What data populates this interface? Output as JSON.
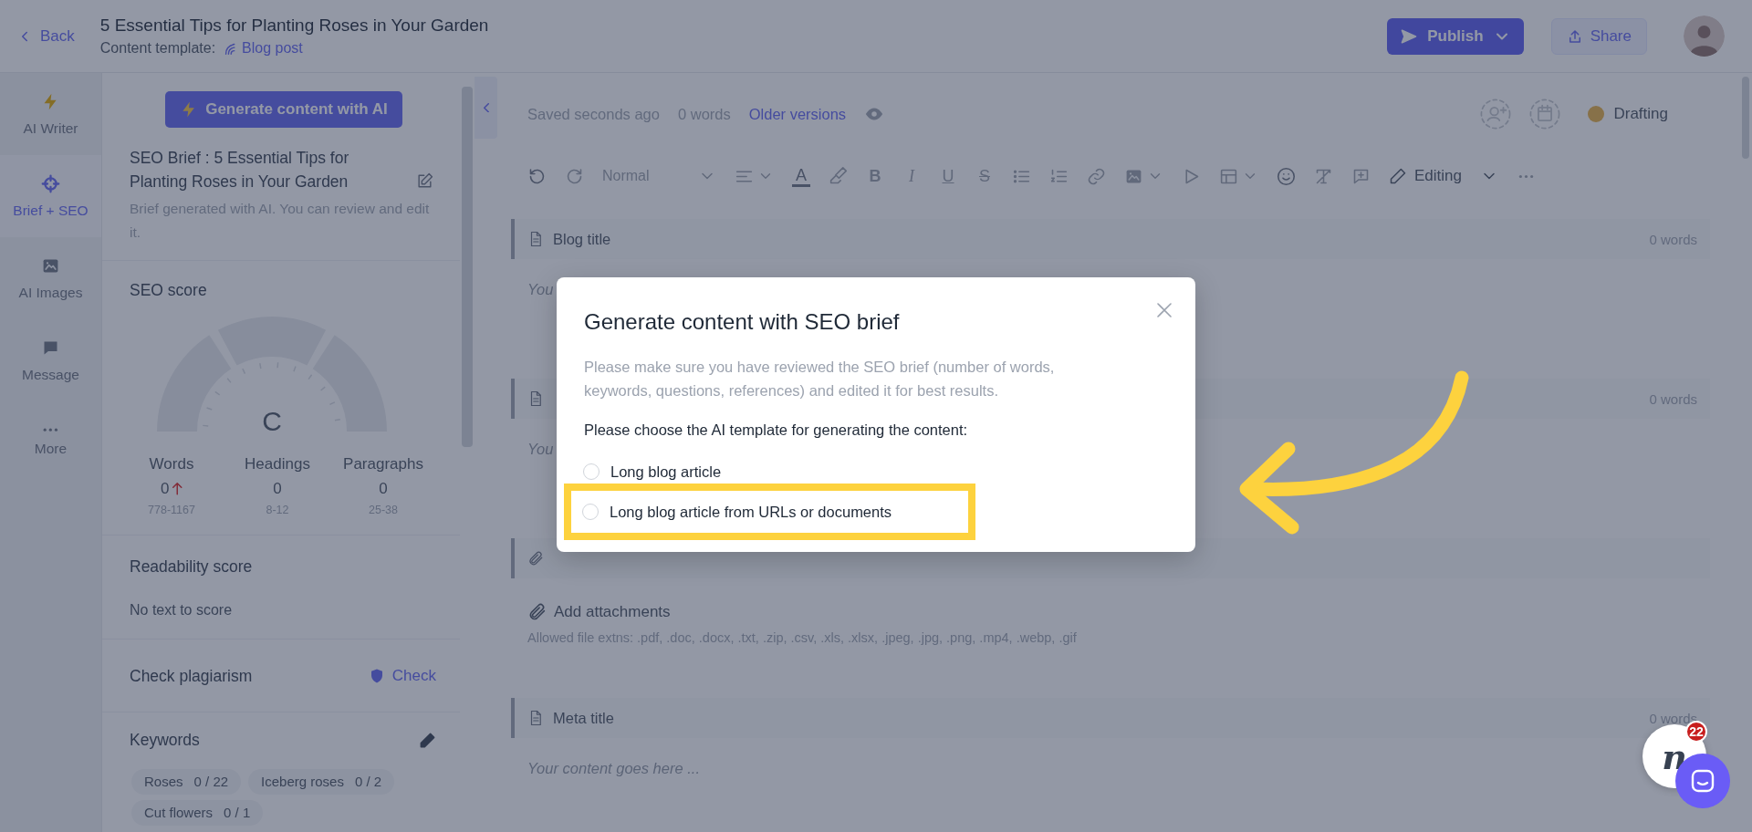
{
  "header": {
    "back": "Back",
    "title": "5 Essential Tips for Planting Roses in Your Garden",
    "template_label": "Content template:",
    "template": "Blog post",
    "publish": "Publish",
    "share": "Share"
  },
  "rail": [
    {
      "label": "AI Writer",
      "selected": false
    },
    {
      "label": "Brief + SEO",
      "selected": true
    },
    {
      "label": "AI Images",
      "selected": false
    },
    {
      "label": "Message",
      "selected": false
    },
    {
      "label": "More",
      "selected": false
    }
  ],
  "brief": {
    "generate_button": "Generate content with AI",
    "title": "SEO Brief : 5 Essential Tips for Planting Roses in Your Garden",
    "note": "Brief generated with AI. You can review and edit it."
  },
  "seo_score": {
    "heading": "SEO score",
    "grade": "C",
    "metrics": [
      {
        "label": "Words",
        "value": "0",
        "range": "778-1167",
        "rising": true
      },
      {
        "label": "Headings",
        "value": "0",
        "range": "8-12",
        "rising": false
      },
      {
        "label": "Paragraphs",
        "value": "0",
        "range": "25-38",
        "rising": false
      }
    ]
  },
  "readability": {
    "heading": "Readability score",
    "text": "No text to score"
  },
  "plagiarism": {
    "heading": "Check plagiarism",
    "action": "Check"
  },
  "keywords": {
    "heading": "Keywords",
    "items": [
      {
        "label": "Roses",
        "count": "0 / 22"
      },
      {
        "label": "Iceberg roses",
        "count": "0 / 2"
      },
      {
        "label": "Cut flowers",
        "count": "0 / 1"
      }
    ]
  },
  "editor": {
    "status": "Saved seconds ago",
    "word_count": "0 words",
    "older_versions": "Older versions",
    "state": "Drafting",
    "toolbar": {
      "style": "Normal",
      "text_color": "A",
      "marks": [
        "B",
        "I",
        "U",
        "S"
      ],
      "mode": "Editing"
    },
    "sections": [
      {
        "kind": "text",
        "title": "Blog title",
        "words": "0 words",
        "placeholder": "You"
      },
      {
        "kind": "text",
        "words": "0 words",
        "placeholder": "You"
      },
      {
        "kind": "attachment",
        "action": "Add attachments",
        "hint": "Allowed file extns: .pdf, .doc, .docx, .txt, .zip, .csv, .xls, .xlsx, .jpeg, .jpg, .png, .mp4, .webp, .gif"
      },
      {
        "kind": "text",
        "title": "Meta title",
        "words": "0 words",
        "placeholder": "Your content goes here ..."
      }
    ]
  },
  "modal": {
    "title": "Generate content with SEO brief",
    "note": "Please make sure you have reviewed the SEO brief (number of words, keywords, questions, references) and edited it for best results.",
    "prompt": "Please choose the AI template for generating the content:",
    "options": [
      {
        "label": "Long blog article",
        "selected": false,
        "highlighted": false
      },
      {
        "label": "Long blog article from URLs or documents",
        "selected": false,
        "highlighted": true
      }
    ]
  },
  "chat": {
    "logo": "n",
    "badge": "22"
  }
}
